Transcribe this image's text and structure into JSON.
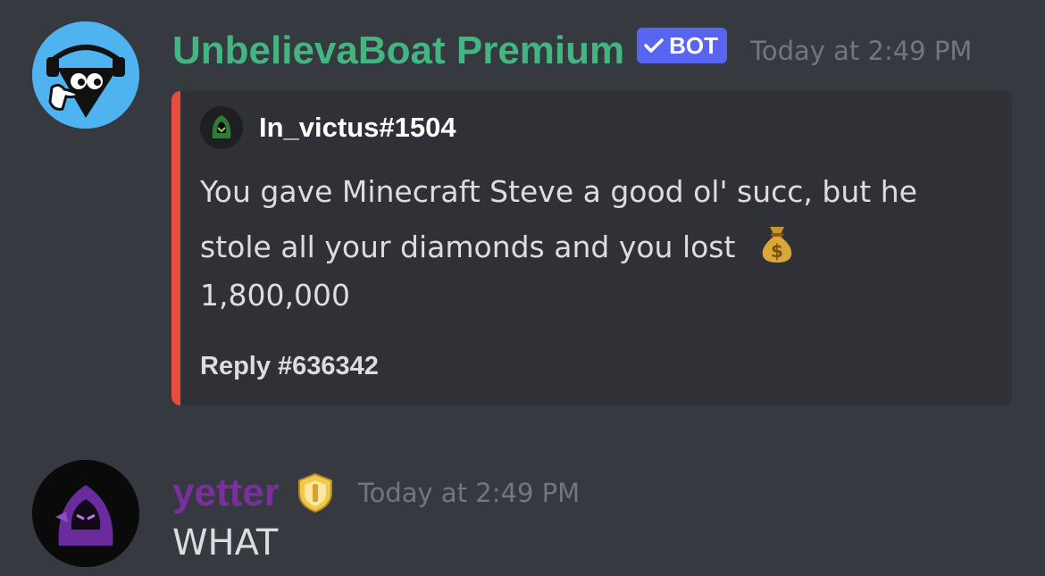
{
  "message1": {
    "username": "UnbelievaBoat Premium",
    "username_color": "#43b581",
    "bot_tag": "BOT",
    "timestamp": "Today at 2:49 PM",
    "embed": {
      "accent_color": "#e74c3c",
      "author": "In_victus#1504",
      "description_lines": [
        "You gave Minecraft Steve a good ol' succ, but he",
        "stole all your diamonds and you lost",
        "1,800,000"
      ],
      "emoji": "money-bag-icon",
      "footer": "Reply #636342"
    }
  },
  "message2": {
    "username": "yetter",
    "username_color": "#7a2f9e",
    "badge": "shield-badge-icon",
    "timestamp": "Today at 2:49 PM",
    "text": "WHAT"
  }
}
